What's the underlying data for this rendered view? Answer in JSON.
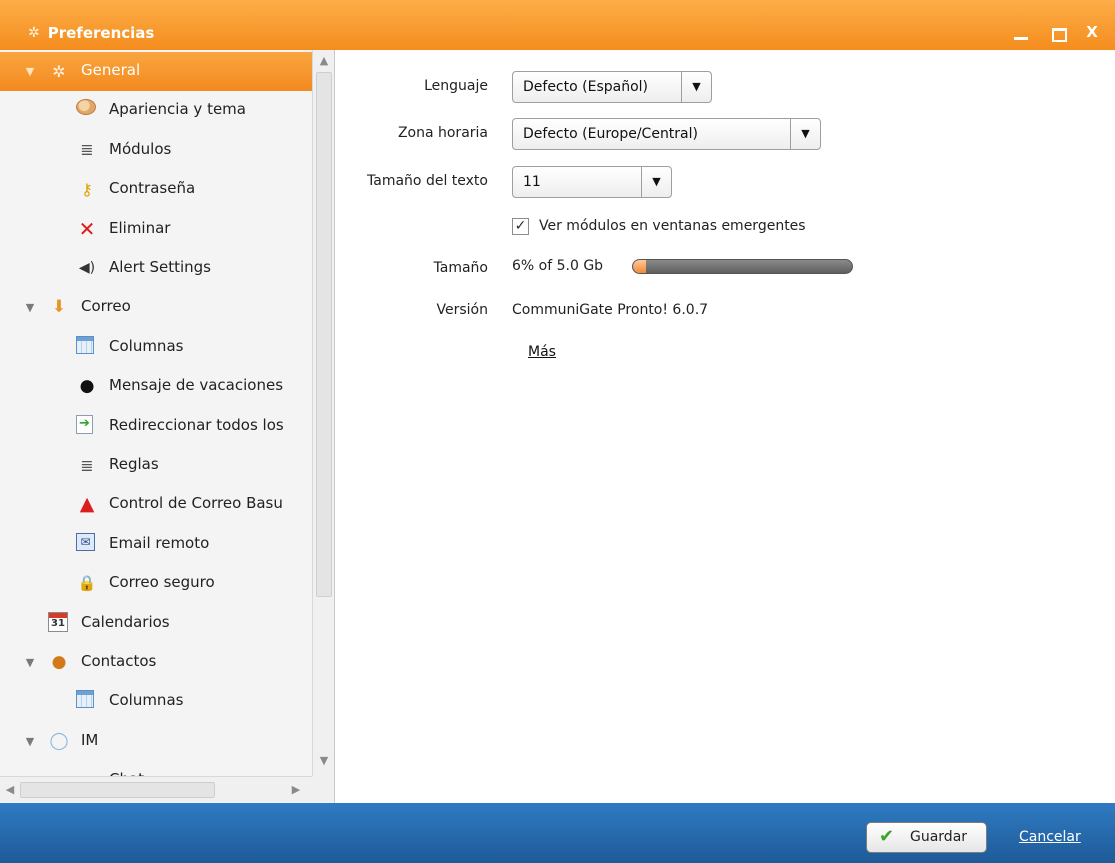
{
  "window": {
    "title": "Preferencias",
    "controls": {
      "minimize": "_",
      "maximize": "□",
      "close": "X"
    }
  },
  "sidebar": {
    "items": [
      {
        "label": "General",
        "icon": "gear-icon",
        "level": 0,
        "expanded": true,
        "selected": true
      },
      {
        "label": "Apariencia y tema",
        "icon": "palette-icon",
        "level": 1
      },
      {
        "label": "Módulos",
        "icon": "list-icon",
        "level": 1
      },
      {
        "label": "Contraseña",
        "icon": "key-icon",
        "level": 1
      },
      {
        "label": "Eliminar",
        "icon": "delete-x-icon",
        "level": 1
      },
      {
        "label": "Alert Settings",
        "icon": "speaker-icon",
        "level": 1
      },
      {
        "label": "Correo",
        "icon": "mail-icon",
        "level": 0,
        "expanded": true
      },
      {
        "label": "Columnas",
        "icon": "grid-icon",
        "level": 1
      },
      {
        "label": "Mensaje de vacaciones",
        "icon": "person-icon",
        "level": 1
      },
      {
        "label": "Redireccionar todos los",
        "icon": "redirect-icon",
        "level": 1
      },
      {
        "label": "Reglas",
        "icon": "list-icon",
        "level": 1
      },
      {
        "label": "Control de Correo Basu",
        "icon": "warning-icon",
        "level": 1
      },
      {
        "label": "Email remoto",
        "icon": "remote-mail-icon",
        "level": 1
      },
      {
        "label": "Correo seguro",
        "icon": "lock-icon",
        "level": 1
      },
      {
        "label": "Calendarios",
        "icon": "calendar-icon",
        "icon_text": "31",
        "level": 0
      },
      {
        "label": "Contactos",
        "icon": "contacts-icon",
        "level": 0,
        "expanded": true
      },
      {
        "label": "Columnas",
        "icon": "grid-icon",
        "level": 1
      },
      {
        "label": "IM",
        "icon": "chat-bubble-icon",
        "level": 0,
        "expanded": true
      },
      {
        "label": "Chat",
        "icon": "list-icon",
        "level": 1
      }
    ]
  },
  "form": {
    "language": {
      "label": "Lenguaje",
      "value": "Defecto (Español)"
    },
    "timezone": {
      "label": "Zona horaria",
      "value": "Defecto (Europe/Central)"
    },
    "text_size": {
      "label": "Tamaño del texto",
      "value": "11"
    },
    "popup_modules": {
      "label": "Ver módulos en ventanas emergentes",
      "checked": true
    },
    "size": {
      "label": "Tamaño",
      "value": "6% of 5.0 Gb",
      "used_percent": 6
    },
    "version": {
      "label": "Versión",
      "value": "CommuniGate Pronto! 6.0.7"
    },
    "more_link": "Más"
  },
  "footer": {
    "save_label": "Guardar",
    "cancel_label": "Cancelar"
  },
  "colors": {
    "accent": "#f58d1e",
    "footer": "#2469ad"
  }
}
